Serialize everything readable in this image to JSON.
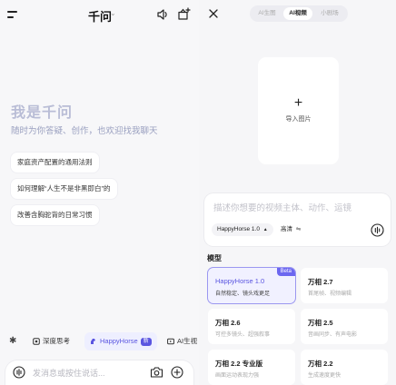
{
  "left": {
    "header": {
      "title": "千问"
    },
    "hero": {
      "title": "我是千问",
      "subtitle": "随时为你答疑、创作，也欢迎找我聊天"
    },
    "suggestions": [
      "家庭资产配置的通用法则",
      "如何理解“人生不是非黑即白”的",
      "改善含胸驼背的日常习惯"
    ],
    "chips": {
      "deep_think": "深度思考",
      "happyhorse": "HappyHorse",
      "new_badge": "新",
      "ai_video": "AI生视"
    },
    "input": {
      "placeholder": "发消息或按住说话..."
    }
  },
  "right": {
    "tabs": [
      "AI生图",
      "AI视频",
      "小剧场"
    ],
    "active_tab": 1,
    "upload": {
      "plus": "+",
      "label": "导入图片"
    },
    "prompt": {
      "placeholder": "描述你想要的视频主体、动作、运镜"
    },
    "model_select": "HappyHorse 1.0",
    "quality_select": "高清",
    "section_title": "模型",
    "models": [
      {
        "name": "HappyHorse 1.0",
        "desc": "自然稳定、镜头戏更足",
        "badge": "Beta",
        "selected": true
      },
      {
        "name": "万相 2.7",
        "desc": "首尾帧、视频编辑",
        "badge": "",
        "selected": false
      },
      {
        "name": "万相 2.6",
        "desc": "可控多镜头、超强叙事",
        "badge": "",
        "selected": false
      },
      {
        "name": "万相 2.5",
        "desc": "音画同步、有声电影",
        "badge": "",
        "selected": false
      },
      {
        "name": "万相 2.2 专业版",
        "desc": "画面运动表现力强",
        "badge": "",
        "selected": false
      },
      {
        "name": "万相 2.2",
        "desc": "生成速度更快",
        "badge": "",
        "selected": false
      }
    ]
  },
  "colors": {
    "accent": "#5a55e0",
    "hero_text": "#b9bdd6"
  },
  "icons": [
    "menu-icon",
    "speaker-icon",
    "new-chat-icon",
    "sparkle-icon",
    "deep-think-icon",
    "horse-icon",
    "video-icon",
    "voice-icon",
    "camera-icon",
    "plus-icon",
    "close-icon",
    "swap-icon",
    "send-voice-icon"
  ]
}
